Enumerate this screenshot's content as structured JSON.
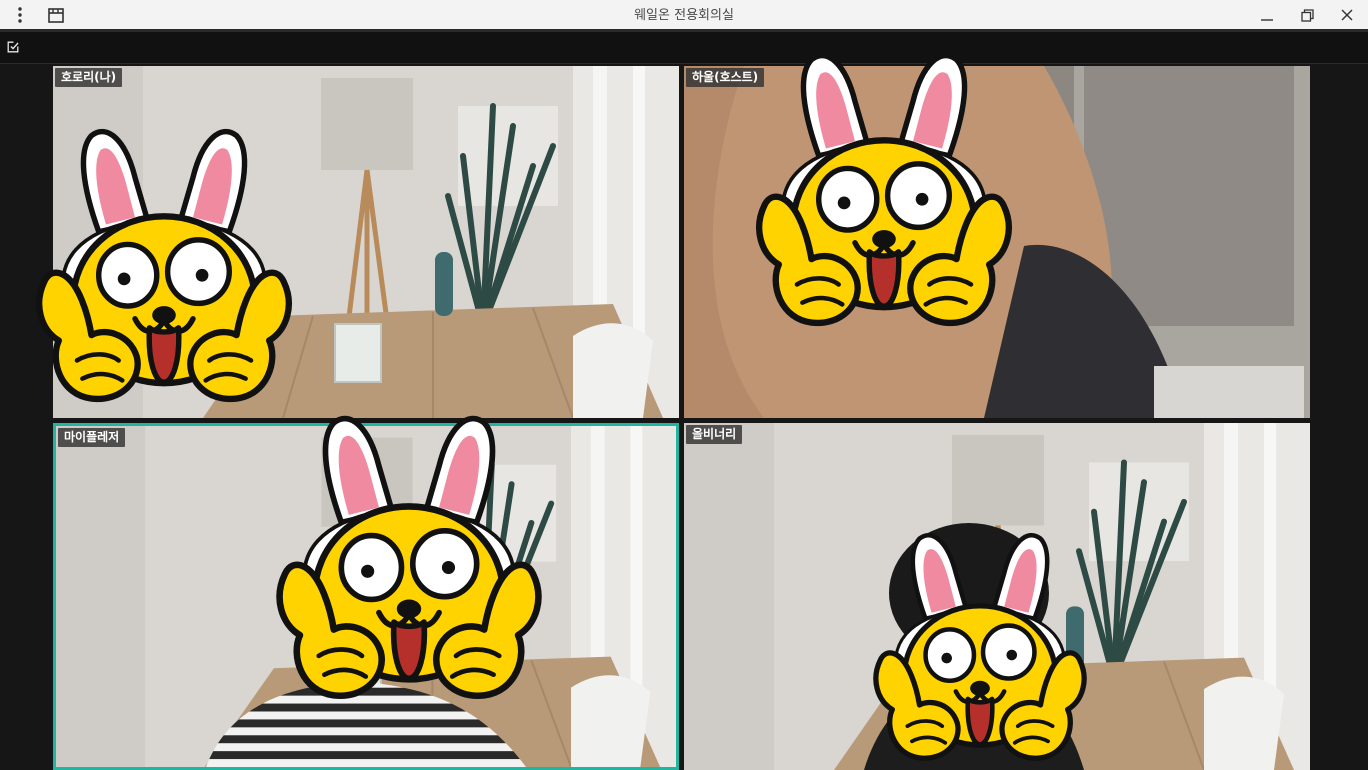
{
  "window": {
    "title": "웨일온 전용회의실",
    "menu_icon": "more-vertical-icon",
    "layout_icon": "window-layout-icon",
    "minimize_icon": "minimize-icon",
    "restore_icon": "restore-icon",
    "close_icon": "close-icon"
  },
  "toolbar": {
    "edit_icon": "edit-checkbox-icon"
  },
  "participants": [
    {
      "name": "호로리(나)",
      "active_speaker": false
    },
    {
      "name": "하울(호스트)",
      "active_speaker": false
    },
    {
      "name": "마이플레저",
      "active_speaker": true
    },
    {
      "name": "올비너리",
      "active_speaker": false
    }
  ],
  "colors": {
    "active_border": "#1fb5a0",
    "sticker_yellow": "#ffd300",
    "titlebar_bg": "#f3f3f3",
    "app_bg": "#161616"
  }
}
